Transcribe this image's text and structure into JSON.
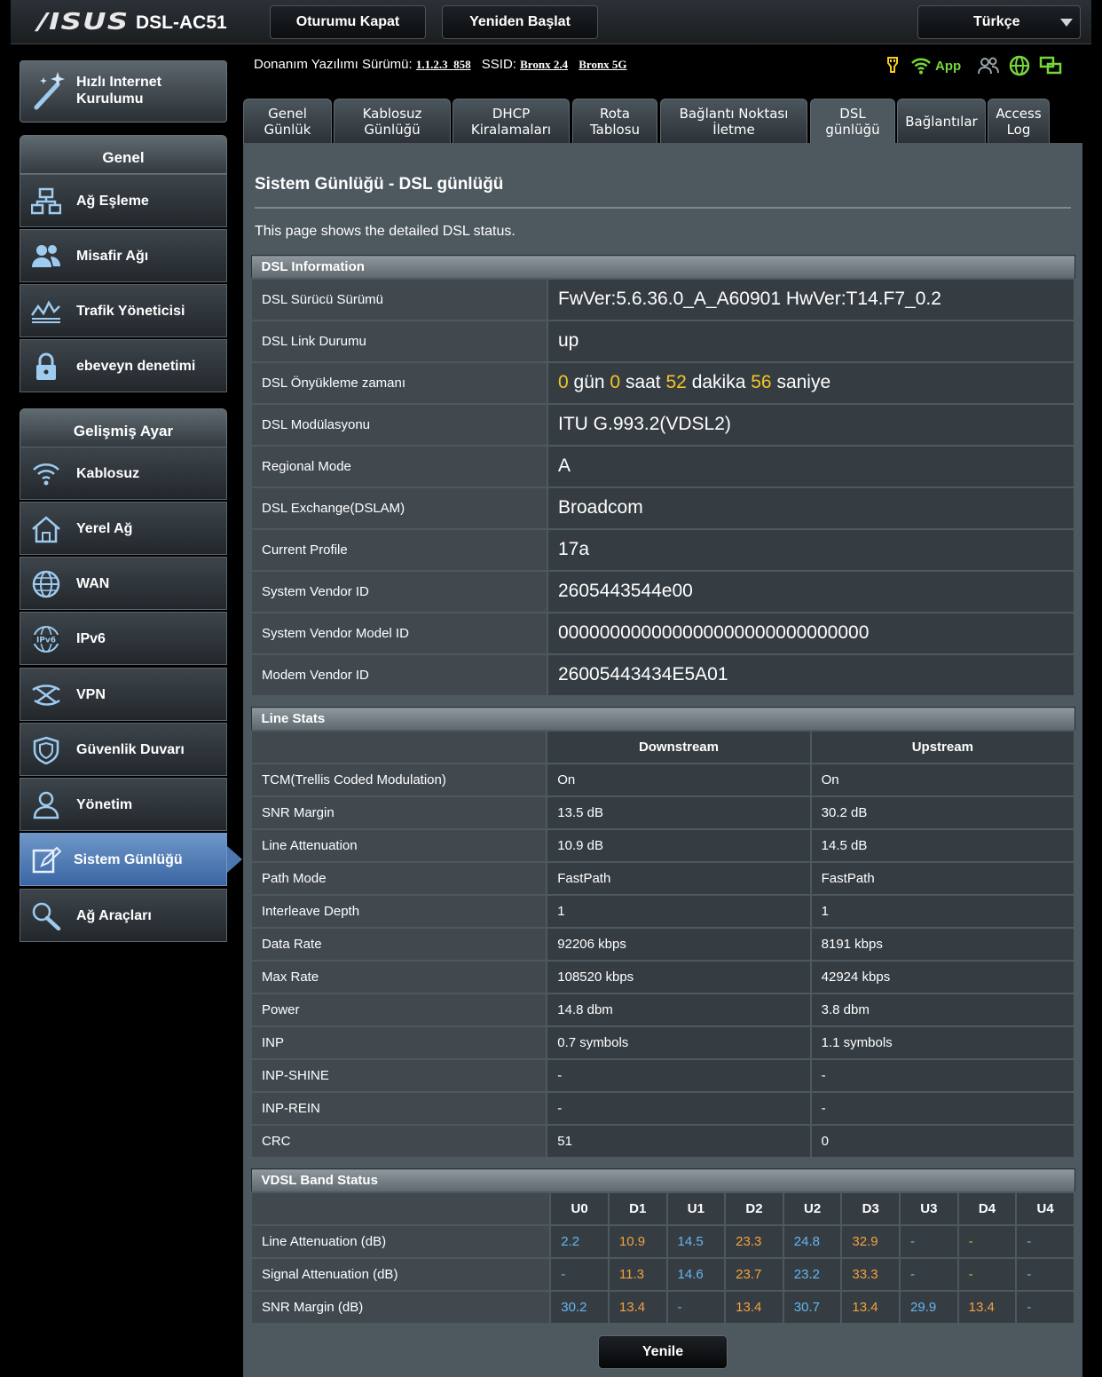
{
  "header": {
    "brand": "/ISUS",
    "model": "DSL-AC51",
    "logout_label": "Oturumu Kapat",
    "reboot_label": "Yeniden Başlat",
    "language": "Türkçe"
  },
  "info": {
    "firmware_label": "Donanım Yazılımı Sürümü:",
    "firmware_value": "1.1.2.3_858",
    "ssid_label": "SSID:",
    "ssid_24": "Bronx 2.4",
    "ssid_5": "Bronx 5G",
    "app_label": "App",
    "status_icons": [
      "usb-icon",
      "wifi-icon",
      "clients-icon",
      "internet-icon",
      "network-icon"
    ]
  },
  "sidebar": {
    "quick_setup": "Hızlı Internet Kurulumu",
    "general_title": "Genel",
    "general_items": [
      {
        "label": "Ağ Eşleme",
        "icon": "network-map-icon"
      },
      {
        "label": "Misafir Ağı",
        "icon": "guest-network-icon"
      },
      {
        "label": "Trafik Yöneticisi",
        "icon": "traffic-icon"
      },
      {
        "label": "ebeveyn denetimi",
        "icon": "lock-icon"
      }
    ],
    "advanced_title": "Gelişmiş Ayar",
    "advanced_items": [
      {
        "label": "Kablosuz",
        "icon": "wireless-icon"
      },
      {
        "label": "Yerel Ağ",
        "icon": "home-icon"
      },
      {
        "label": "WAN",
        "icon": "globe-icon"
      },
      {
        "label": "IPv6",
        "icon": "ipv6-icon"
      },
      {
        "label": "VPN",
        "icon": "vpn-icon"
      },
      {
        "label": "Güvenlik Duvarı",
        "icon": "shield-icon"
      },
      {
        "label": "Yönetim",
        "icon": "admin-icon"
      },
      {
        "label": "Sistem Günlüğü",
        "icon": "log-icon"
      },
      {
        "label": "Ağ Araçları",
        "icon": "tools-icon"
      }
    ]
  },
  "tabs": [
    "Genel\nGünlük",
    "Kablosuz\nGünlüğü",
    "DHCP\nKiralamaları",
    "Rota\nTablosu",
    "Bağlantı Noktası\nİletme",
    "DSL\ngünlüğü",
    "Bağlantılar",
    "Access\nLog"
  ],
  "page": {
    "title": "Sistem Günlüğü - DSL günlüğü",
    "description": "This page shows the detailed DSL status."
  },
  "dsl_info": {
    "title": "DSL Information",
    "rows": [
      {
        "label": "DSL Sürücü Sürümü",
        "value": "FwVer:5.6.36.0_A_A60901 HwVer:T14.F7_0.2"
      },
      {
        "label": "DSL Link Durumu",
        "value": "up"
      },
      {
        "label": "DSL Önyükleme zamanı",
        "value": ""
      },
      {
        "label": "DSL Modülasyonu",
        "value": "ITU G.993.2(VDSL2)"
      },
      {
        "label": "Regional Mode",
        "value": "A"
      },
      {
        "label": "DSL Exchange(DSLAM)",
        "value": "Broadcom"
      },
      {
        "label": "Current Profile",
        "value": "17a"
      },
      {
        "label": "System Vendor ID",
        "value": "2605443544e00"
      },
      {
        "label": "System Vendor Model ID",
        "value": "000000000000000000000000000000"
      },
      {
        "label": "Modem Vendor ID",
        "value": "26005443434E5A01"
      }
    ],
    "uptime": {
      "days": "0",
      "days_unit": "gün",
      "hours": "0",
      "hours_unit": "saat",
      "minutes": "52",
      "minutes_unit": "dakika",
      "seconds": "56",
      "seconds_unit": "saniye"
    }
  },
  "line_stats": {
    "title": "Line Stats",
    "col_down": "Downstream",
    "col_up": "Upstream",
    "rows": [
      {
        "label": "TCM(Trellis Coded Modulation)",
        "down": "On",
        "up": "On"
      },
      {
        "label": "SNR Margin",
        "down": "13.5 dB",
        "up": "30.2 dB"
      },
      {
        "label": "Line Attenuation",
        "down": "10.9 dB",
        "up": "14.5 dB"
      },
      {
        "label": "Path Mode",
        "down": "FastPath",
        "up": "FastPath"
      },
      {
        "label": "Interleave Depth",
        "down": "1",
        "up": "1"
      },
      {
        "label": "Data Rate",
        "down": "92206 kbps",
        "up": "8191 kbps"
      },
      {
        "label": "Max Rate",
        "down": "108520 kbps",
        "up": "42924 kbps"
      },
      {
        "label": "Power",
        "down": "14.8 dbm",
        "up": "3.8 dbm"
      },
      {
        "label": "INP",
        "down": "0.7 symbols",
        "up": "1.1 symbols"
      },
      {
        "label": "INP-SHINE",
        "down": "-",
        "up": "-"
      },
      {
        "label": "INP-REIN",
        "down": "-",
        "up": "-"
      },
      {
        "label": "CRC",
        "down": "51",
        "up": "0"
      }
    ]
  },
  "vdsl": {
    "title": "VDSL Band Status",
    "bands": [
      "U0",
      "D1",
      "U1",
      "D2",
      "U2",
      "D3",
      "U3",
      "D4",
      "U4"
    ],
    "rows": [
      {
        "label": "Line Attenuation (dB)",
        "values": [
          "2.2",
          "10.9",
          "14.5",
          "23.3",
          "24.8",
          "32.9",
          "-",
          "-",
          "-"
        ]
      },
      {
        "label": "Signal Attenuation (dB)",
        "values": [
          "-",
          "11.3",
          "14.6",
          "23.7",
          "23.2",
          "33.3",
          "-",
          "-",
          "-"
        ]
      },
      {
        "label": "SNR Margin (dB)",
        "values": [
          "30.2",
          "13.4",
          "-",
          "13.4",
          "30.7",
          "13.4",
          "29.9",
          "13.4",
          "-"
        ]
      }
    ],
    "colors": {
      "upstream": "#64b5f0",
      "downstream": "#f2a13e"
    }
  },
  "refresh_label": "Yenile",
  "colors": {
    "accent": "#f5c526",
    "active_menu": "#4d77b0",
    "panel": "#4d585f"
  }
}
